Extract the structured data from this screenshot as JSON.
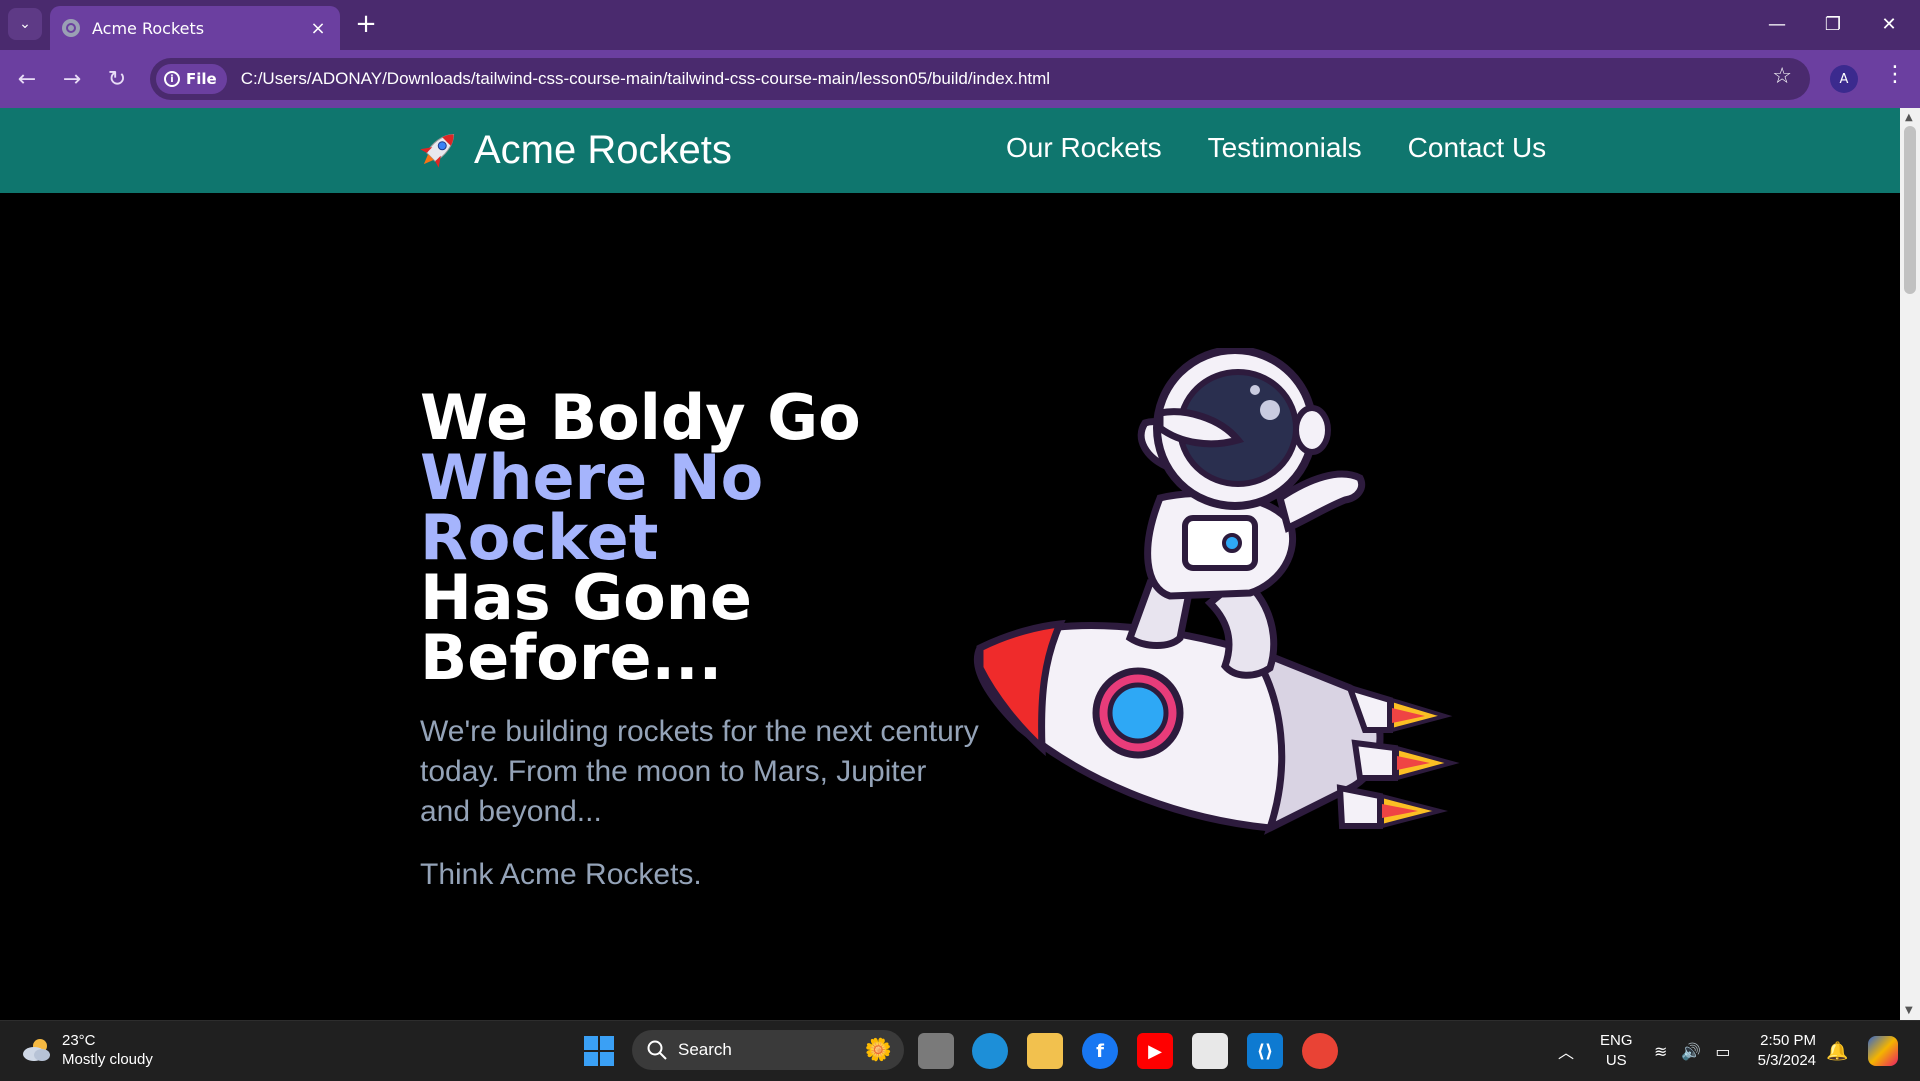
{
  "browser": {
    "tab_title": "Acme Rockets",
    "scheme_chip": "File",
    "url": "C:/Users/ADONAY/Downloads/tailwind-css-course-main/tailwind-css-course-main/lesson05/build/index.html",
    "profile_initial": "A"
  },
  "site": {
    "brand_emoji": "🚀",
    "brand_name": "Acme Rockets",
    "nav": [
      "Our Rockets",
      "Testimonials",
      "Contact Us"
    ],
    "headline_line1": "We Boldy Go",
    "headline_accent": "Where No Rocket",
    "headline_line3": "Has Gone",
    "headline_line4": "Before...",
    "lede": "We're building rockets for the next century today. From the moon to Mars, Jupiter and beyond...",
    "tagline": "Think Acme Rockets.",
    "accent_color": "#a5b4fc",
    "header_color": "#0f766e"
  },
  "taskbar": {
    "weather_temp": "23°C",
    "weather_desc": "Mostly cloudy",
    "search_label": "Search",
    "lang_line1": "ENG",
    "lang_line2": "US",
    "time": "2:50 PM",
    "date": "5/3/2024"
  }
}
